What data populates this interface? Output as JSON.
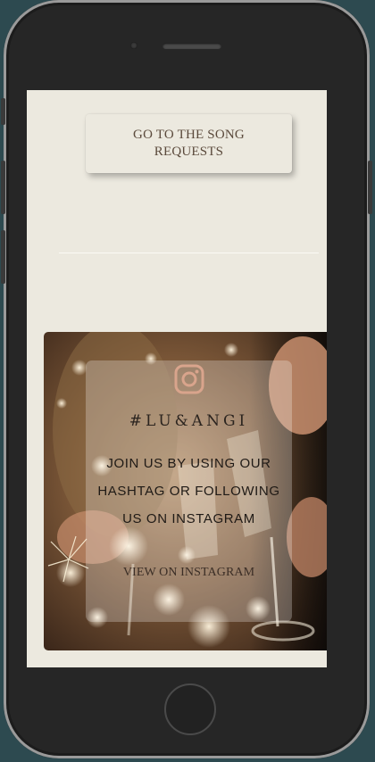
{
  "song_requests": {
    "button_label": "GO TO THE SONG REQUESTS"
  },
  "instagram": {
    "icon": "instagram-icon",
    "hashtag": "#LU&ANGI",
    "description": "JOIN US BY USING OUR HASHTAG OR FOLLOWING US ON INSTAGRAM",
    "link_label": "VIEW ON INSTAGRAM"
  },
  "colors": {
    "page_background": "#ece9df",
    "button_text": "#5b4a3c",
    "icon_tint": "#d9a48c"
  }
}
